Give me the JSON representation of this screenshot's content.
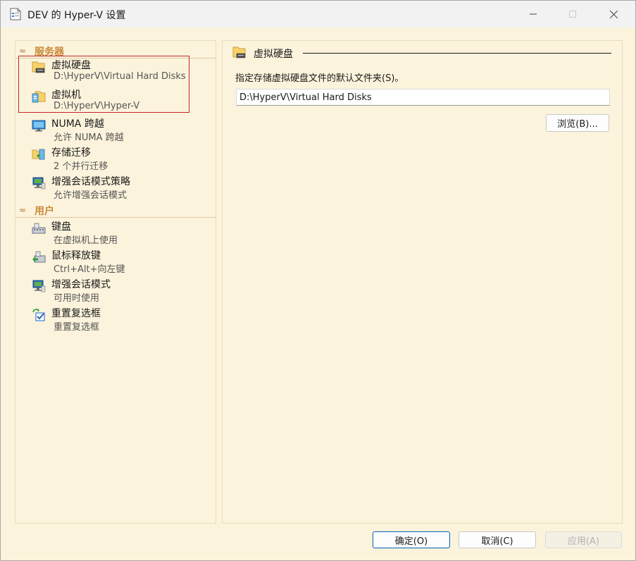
{
  "window": {
    "title": "DEV 的 Hyper-V 设置",
    "controls": {
      "minimize": "—",
      "maximize": "☐",
      "close": "✕"
    }
  },
  "sidebar": {
    "sections": [
      {
        "label": "服务器",
        "items": [
          {
            "label": "虚拟硬盘",
            "sub": "D:\\HyperV\\Virtual Hard Disks",
            "icon": "folder-disk-icon"
          },
          {
            "label": "虚拟机",
            "sub": "D:\\HyperV\\Hyper-V",
            "icon": "folder-vm-icon"
          },
          {
            "label": "NUMA 跨越",
            "sub": "允许 NUMA 跨越",
            "icon": "monitor-icon"
          },
          {
            "label": "存储迁移",
            "sub": "2 个并行迁移",
            "icon": "storage-migration-icon"
          },
          {
            "label": "增强会话模式策略",
            "sub": "允许增强会话模式",
            "icon": "enhanced-session-icon"
          }
        ]
      },
      {
        "label": "用户",
        "items": [
          {
            "label": "键盘",
            "sub": "在虚拟机上使用",
            "icon": "keyboard-icon"
          },
          {
            "label": "鼠标释放键",
            "sub": "Ctrl+Alt+向左键",
            "icon": "mouse-release-icon"
          },
          {
            "label": "增强会话模式",
            "sub": "可用时使用",
            "icon": "enhanced-session-icon"
          },
          {
            "label": "重置复选框",
            "sub": "重置复选框",
            "icon": "reset-checkbox-icon"
          }
        ]
      }
    ]
  },
  "main": {
    "header": "虚拟硬盘",
    "description": "指定存储虚拟硬盘文件的默认文件夹(S)。",
    "path_value": "D:\\HyperV\\Virtual Hard Disks",
    "browse_label": "浏览(B)..."
  },
  "footer": {
    "ok_label": "确定(O)",
    "cancel_label": "取消(C)",
    "apply_label": "应用(A)"
  },
  "colors": {
    "background": "#fcf3dc",
    "section_header": "#c98a3a",
    "highlight_border": "#c0262a",
    "primary_button_border": "#005fb8"
  }
}
